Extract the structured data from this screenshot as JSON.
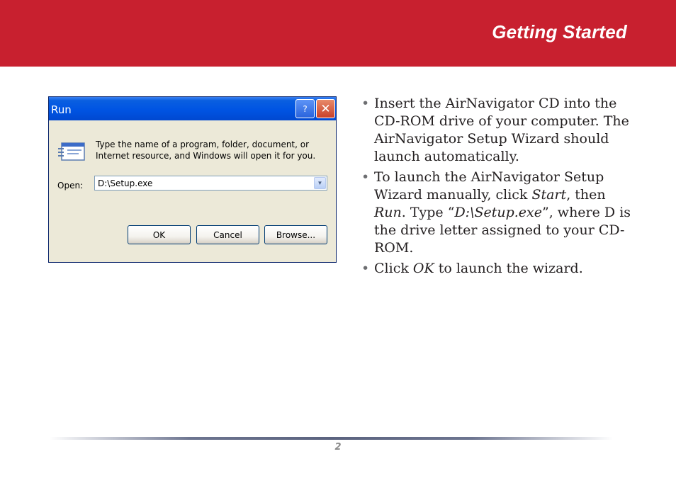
{
  "header": {
    "title": "Getting Started",
    "color": "#c8202f"
  },
  "dialog": {
    "title": "Run",
    "help_label": "?",
    "close_label": "✕",
    "prompt": "Type the name of a program, folder, document, or Internet resource, and Windows will open it for you.",
    "open_label": "Open:",
    "open_value": "D:\\Setup.exe",
    "buttons": {
      "ok": "OK",
      "cancel": "Cancel",
      "browse": "Browse..."
    },
    "icon": "run-dialog-icon"
  },
  "instructions": [
    {
      "parts": [
        "Insert the AirNavigator CD into the CD-ROM drive of your computer. The AirNavigator Setup Wizard should launch automatically."
      ]
    },
    {
      "parts": [
        "To launch the AirNavigator Setup Wizard manually, click ",
        "Start",
        ", then ",
        "Run",
        ".  Type “",
        "D:\\Setup.exe",
        "”, where D is the drive letter assigned to your CD-ROM."
      ]
    },
    {
      "parts": [
        "Click ",
        "OK",
        " to launch the wizard."
      ]
    }
  ],
  "footer": {
    "page_number": "2"
  }
}
